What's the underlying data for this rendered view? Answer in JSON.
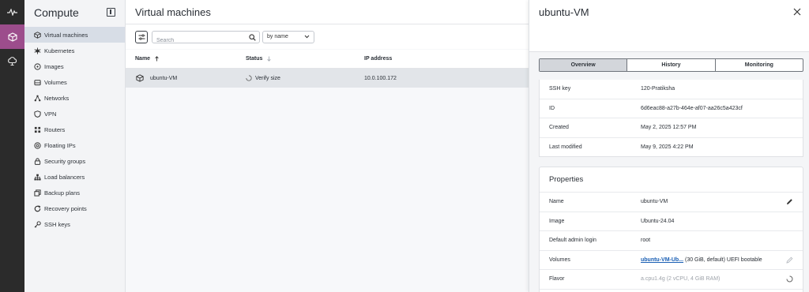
{
  "rail": {
    "items": [
      {
        "name": "activity-icon"
      },
      {
        "name": "compute-cube-icon"
      },
      {
        "name": "cloud-storage-icon"
      }
    ]
  },
  "sidebar": {
    "title": "Compute",
    "items": [
      {
        "label": "Virtual machines",
        "icon": "cube-icon"
      },
      {
        "label": "Kubernetes",
        "icon": "kubernetes-icon"
      },
      {
        "label": "Images",
        "icon": "image-disc-icon"
      },
      {
        "label": "Volumes",
        "icon": "volume-icon"
      },
      {
        "label": "Networks",
        "icon": "network-icon"
      },
      {
        "label": "VPN",
        "icon": "shield-icon"
      },
      {
        "label": "Routers",
        "icon": "router-icon"
      },
      {
        "label": "Floating IPs",
        "icon": "globe-icon"
      },
      {
        "label": "Security groups",
        "icon": "lock-icon"
      },
      {
        "label": "Load balancers",
        "icon": "load-balancer-icon"
      },
      {
        "label": "Backup plans",
        "icon": "backup-icon"
      },
      {
        "label": "Recovery points",
        "icon": "recovery-icon"
      },
      {
        "label": "SSH keys",
        "icon": "key-icon"
      }
    ]
  },
  "main": {
    "title": "Virtual machines",
    "search": {
      "placeholder": "Search"
    },
    "sort": {
      "value": "by name"
    },
    "columns": {
      "name": "Name",
      "status": "Status",
      "ip": "IP address"
    },
    "rows": [
      {
        "name": "ubuntu-VM",
        "status": "Verify size",
        "ip": "10.0.100.172"
      }
    ]
  },
  "panel": {
    "title": "ubuntu-VM",
    "tabs": [
      "Overview",
      "History",
      "Monitoring"
    ],
    "details": [
      {
        "key": "SSH key",
        "value": "120-Pratiksha"
      },
      {
        "key": "ID",
        "value": "6d6eac88-a27b-464e-af07-aa26c5a423cf"
      },
      {
        "key": "Created",
        "value": "May 2, 2025 12:57 PM"
      },
      {
        "key": "Last modified",
        "value": "May 9, 2025 4:22 PM"
      }
    ],
    "properties": {
      "title": "Properties",
      "name": {
        "key": "Name",
        "value": "ubuntu-VM"
      },
      "image": {
        "key": "Image",
        "value": "Ubuntu-24.04"
      },
      "admin": {
        "key": "Default admin login",
        "value": "root"
      },
      "volumes": {
        "key": "Volumes",
        "link": "ubuntu-VM-Ub...",
        "rest": " (30 GiB, default) UEFI bootable"
      },
      "flavor": {
        "key": "Flavor",
        "value": "a.cpu1.4g",
        "rest": " (2 vCPU, 4 GiB RAM)"
      }
    }
  },
  "colors": {
    "rail_bg": "#2b2b2b",
    "rail_active": "#9c4d8c",
    "sidebar_bg": "#f3f4f6",
    "sidebar_active": "#d7dde6",
    "link": "#1a5fb4"
  }
}
